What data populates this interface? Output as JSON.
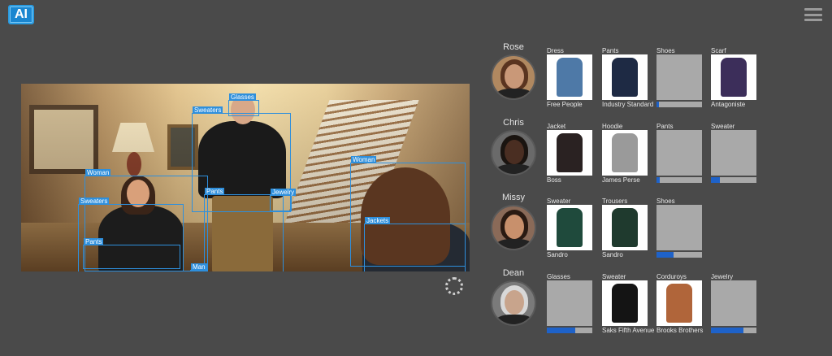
{
  "app": {
    "logo_text": "AI"
  },
  "detections": [
    {
      "label": "Glasses"
    },
    {
      "label": "Sweaters"
    },
    {
      "label": "Woman"
    },
    {
      "label": "Woman"
    },
    {
      "label": "Sweaters"
    },
    {
      "label": "Pants"
    },
    {
      "label": "Jewelry"
    },
    {
      "label": "Jackets"
    },
    {
      "label": "Pants"
    },
    {
      "label": "Man"
    }
  ],
  "people": [
    {
      "name": "Rose",
      "items": [
        {
          "category": "Dress",
          "brand": "Free People",
          "status": "product",
          "color": "#4e79a7"
        },
        {
          "category": "Pants",
          "brand": "Industry Standard",
          "status": "product",
          "color": "#1e2a44"
        },
        {
          "category": "Shoes",
          "brand": "",
          "status": "loading",
          "progress": 0.05
        },
        {
          "category": "Scarf",
          "brand": "Antagoniste",
          "status": "product",
          "color": "#3c2e5a"
        }
      ]
    },
    {
      "name": "Chris",
      "items": [
        {
          "category": "Jacket",
          "brand": "Boss",
          "status": "product",
          "color": "#2a2222"
        },
        {
          "category": "Hoodie",
          "brand": "James Perse",
          "status": "product",
          "color": "#9a9a9a"
        },
        {
          "category": "Pants",
          "brand": "",
          "status": "loading",
          "progress": 0.08
        },
        {
          "category": "Sweater",
          "brand": "",
          "status": "loading",
          "progress": 0.2
        }
      ]
    },
    {
      "name": "Missy",
      "items": [
        {
          "category": "Sweater",
          "brand": "Sandro",
          "status": "product",
          "color": "#1f4a3c"
        },
        {
          "category": "Trousers",
          "brand": "Sandro",
          "status": "product",
          "color": "#1f3a2e"
        },
        {
          "category": "Shoes",
          "brand": "",
          "status": "loading",
          "progress": 0.38
        }
      ]
    },
    {
      "name": "Dean",
      "items": [
        {
          "category": "Glasses",
          "brand": "",
          "status": "loading",
          "progress": 0.62
        },
        {
          "category": "Sweater",
          "brand": "Saks Fifth Avenue",
          "status": "product",
          "color": "#141414"
        },
        {
          "category": "Corduroys",
          "brand": "Brooks Brothers",
          "status": "product",
          "color": "#b0653a"
        },
        {
          "category": "Jewelry",
          "brand": "",
          "status": "loading",
          "progress": 0.72
        }
      ]
    }
  ],
  "colors": {
    "accent": "#2e8fdc",
    "progress": "#1e62c9",
    "background": "#4a4a4a",
    "placeholder": "#a9a9a9"
  }
}
